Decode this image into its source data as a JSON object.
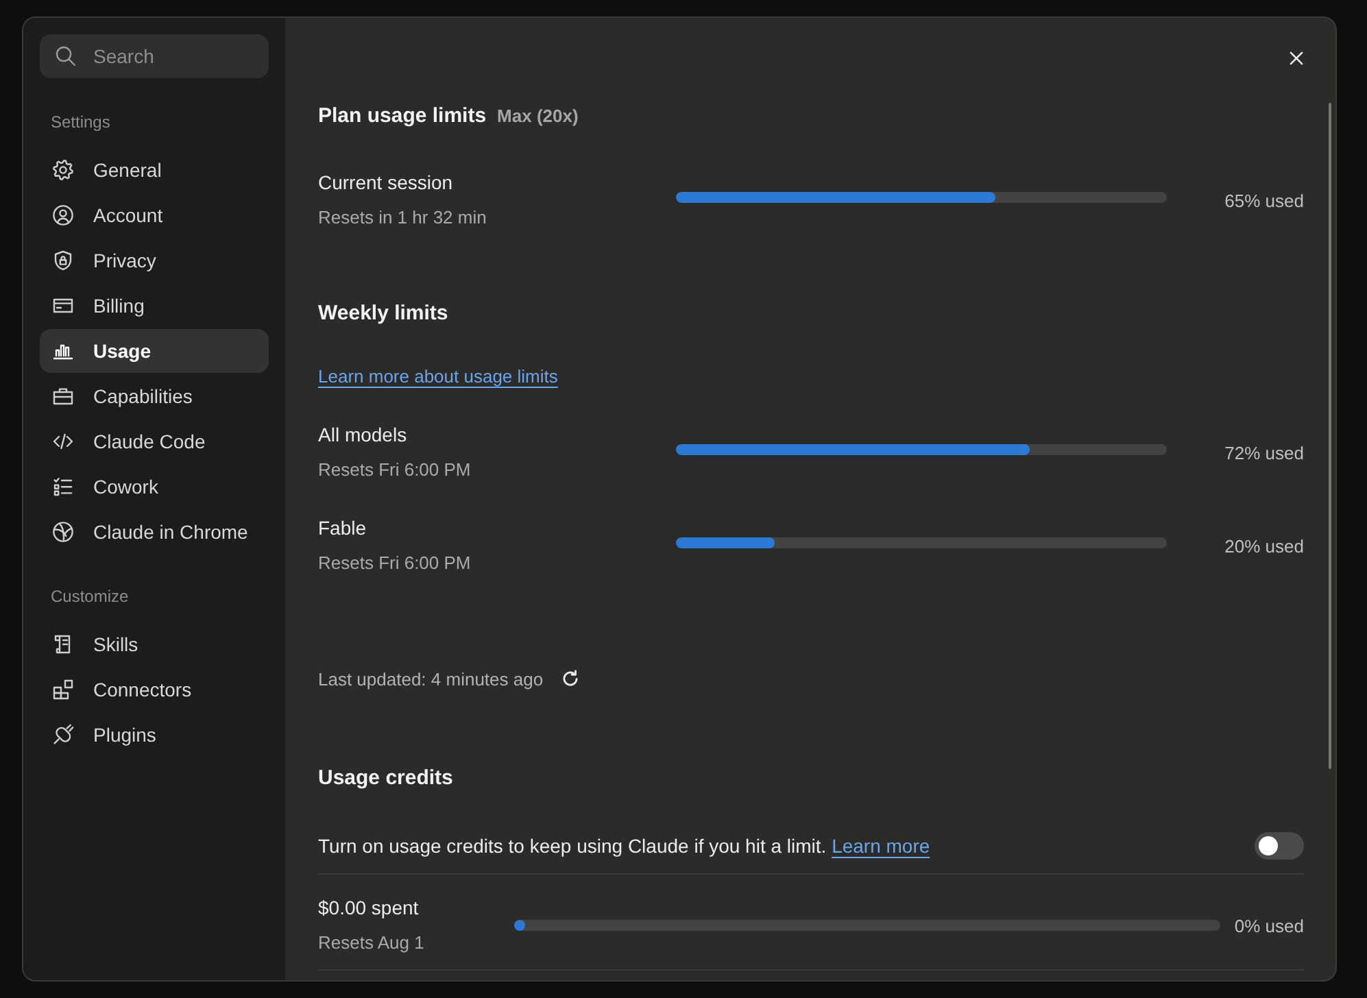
{
  "sidebar": {
    "search": {
      "placeholder": "Search"
    },
    "sections": [
      {
        "title": "Settings",
        "items": [
          {
            "label": "General",
            "selected": false
          },
          {
            "label": "Account",
            "selected": false
          },
          {
            "label": "Privacy",
            "selected": false
          },
          {
            "label": "Billing",
            "selected": false
          },
          {
            "label": "Usage",
            "selected": true
          },
          {
            "label": "Capabilities",
            "selected": false
          },
          {
            "label": "Claude Code",
            "selected": false
          },
          {
            "label": "Cowork",
            "selected": false
          },
          {
            "label": "Claude in Chrome",
            "selected": false
          }
        ]
      },
      {
        "title": "Customize",
        "items": [
          {
            "label": "Skills",
            "selected": false
          },
          {
            "label": "Connectors",
            "selected": false
          },
          {
            "label": "Plugins",
            "selected": false
          }
        ]
      }
    ]
  },
  "plan": {
    "title": "Plan usage limits",
    "tier": "Max (20x)"
  },
  "session": {
    "label": "Current session",
    "resets": "Resets in 1 hr 32 min",
    "level": 0.65,
    "reading": "65% used"
  },
  "weekly": {
    "title": "Weekly limits",
    "link": "Learn more about usage limits",
    "limits": [
      {
        "label": "All models",
        "resets": "Resets Fri 6:00 PM",
        "level": 0.72,
        "reading": "72% used"
      },
      {
        "label": "Fable",
        "resets": "Resets Fri 6:00 PM",
        "level": 0.2,
        "reading": "20% used"
      }
    ]
  },
  "last_updated": "Last updated: 4 minutes ago",
  "credits": {
    "title": "Usage credits",
    "description": "Turn on usage credits to keep using Claude if you hit a limit.",
    "link": "Learn more",
    "on": false,
    "spent": {
      "label": "$0.00 spent",
      "resets": "Resets Aug 1",
      "level": 0,
      "reading": "0% used"
    }
  }
}
